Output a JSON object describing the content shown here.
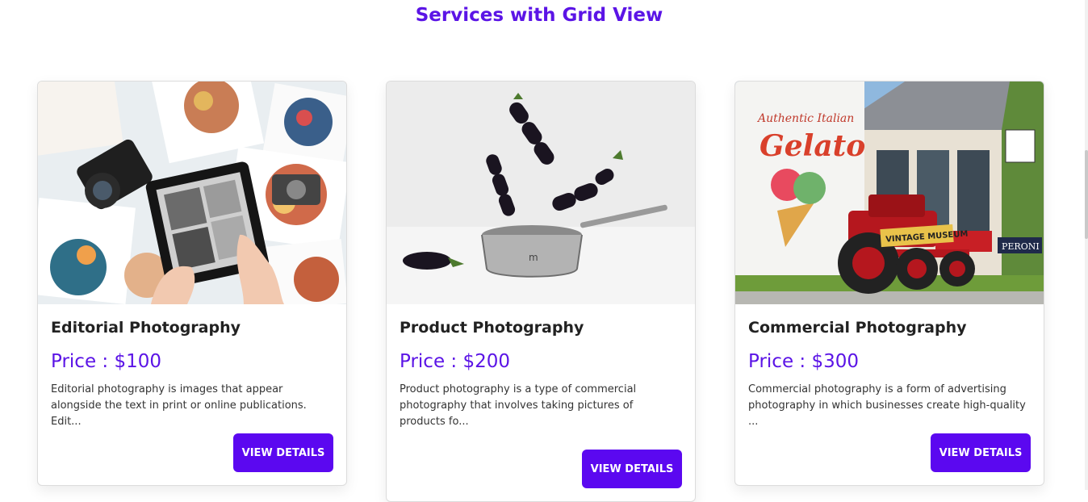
{
  "section": {
    "title": "Services with Grid View"
  },
  "services": [
    {
      "title": "Editorial Photography",
      "price": "Price : $100",
      "description": "Editorial photography is images that appear alongside the text in print or online publications. Edit...",
      "button": "VIEW DETAILS",
      "image_icon": "editorial-photo-collage-image"
    },
    {
      "title": "Product Photography",
      "price": "Price : $200",
      "description": "Product photography is a type of commercial photography that involves taking pictures of products fo...",
      "button": "VIEW DETAILS",
      "image_icon": "eggplant-pan-product-image"
    },
    {
      "title": "Commercial Photography",
      "price": "Price : $300",
      "description": "Commercial photography is a form of advertising photography in which businesses create high-quality ...",
      "button": "VIEW DETAILS",
      "image_icon": "gelato-shop-tractor-image"
    }
  ],
  "image_text": {
    "gelato_sign_line1": "Authentic Italian",
    "gelato_sign_line2": "Gelato",
    "tractor_sign": "VINTAGE MUSEUM",
    "peroni_sign": "PERONI"
  },
  "colors": {
    "accent": "#5b14e6",
    "button": "#5b08f0"
  }
}
